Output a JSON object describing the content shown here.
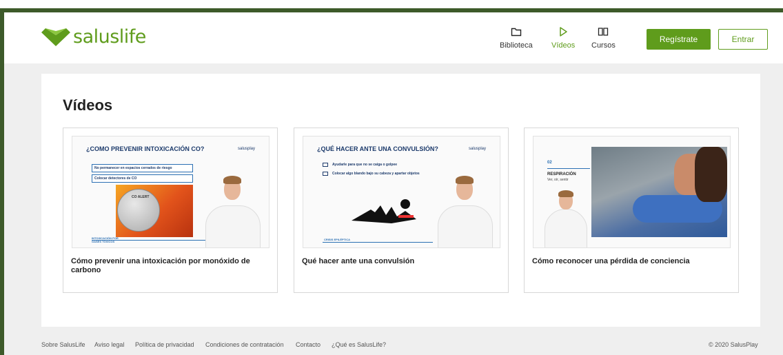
{
  "header": {
    "logo_text": "saluslife",
    "nav": [
      {
        "label": "Biblioteca",
        "icon": "folder-icon",
        "active": false
      },
      {
        "label": "Vídeos",
        "icon": "play-icon",
        "active": true
      },
      {
        "label": "Cursos",
        "icon": "book-icon",
        "active": false
      }
    ],
    "register_label": "Regístrate",
    "login_label": "Entrar"
  },
  "main": {
    "title": "Vídeos",
    "cards": [
      {
        "title": "Cómo prevenir una intoxicación por monóxido de carbono",
        "slide_title": "¿COMO PREVENIR INTOXICACIÓN CO?",
        "brand": "salusplay",
        "bullets": [
          "No permanecer en espacios cerrados de riesgo",
          "Colocar detectores de CO"
        ],
        "device_label": "CO ALERT",
        "footer_tag": "INTOXICACIÓN POR GASES TÓXICOS"
      },
      {
        "title": "Qué hacer ante una convulsión",
        "slide_title": "¿QUÉ HACER ANTE UNA CONVULSIÓN?",
        "brand": "salusplay",
        "bullets": [
          "Ayudarle para que no se caiga o golpee",
          "Colocar algo blando bajo su cabeza y apartar objetos"
        ],
        "footer_tag": "CRISIS EPILÉPTICA"
      },
      {
        "title": "Cómo reconocer una pérdida de conciencia",
        "step": "02",
        "slide_heading": "RESPIRACIÓN",
        "slide_sub": "Ver, oír, sentir"
      }
    ]
  },
  "footer": {
    "links": [
      "Sobre SalusLife",
      "Aviso legal",
      "Política de privacidad",
      "Condiciones de contratación",
      "Contacto",
      "¿Qué es SalusLife?"
    ],
    "copyright": "© 2020 SalusPlay"
  },
  "colors": {
    "brand_green": "#5f9c1c",
    "frame_green": "#3d5a2a",
    "slide_blue": "#1c3a6b"
  }
}
